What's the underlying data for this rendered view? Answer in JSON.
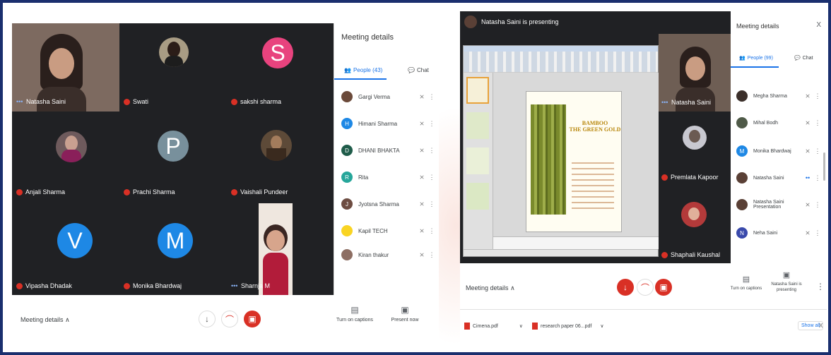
{
  "left": {
    "tiles": [
      {
        "name": "Natasha Saini"
      },
      {
        "name": "Swati"
      },
      {
        "name": "sakshi sharma",
        "initial": "S"
      },
      {
        "name": "Anjali Sharma"
      },
      {
        "name": "Prachi Sharma",
        "initial": "P"
      },
      {
        "name": "Vaishali Pundeer"
      },
      {
        "name": "Vipasha Dhadak",
        "initial": "V"
      },
      {
        "name": "Monika Bhardwaj",
        "initial": "M"
      },
      {
        "name": "Sharnja M"
      }
    ],
    "panel": {
      "title": "Meeting details",
      "tab_people": "People (43)",
      "tab_chat": "Chat",
      "people": [
        {
          "name": "Gargi Verma"
        },
        {
          "name": "Himani Sharma",
          "initial": "H"
        },
        {
          "name": "DHANI BHAKTA",
          "initial": "D"
        },
        {
          "name": "Rita",
          "initial": "R"
        },
        {
          "name": "Jyotsna Sharma",
          "initial": "J"
        },
        {
          "name": "Kapil TECH"
        },
        {
          "name": "Kiran thakur"
        }
      ]
    },
    "bottom": {
      "meeting_details": "Meeting details",
      "captions_label": "Turn on captions",
      "present_label": "Present now"
    }
  },
  "right": {
    "presenting_banner": "Natasha Saini is presenting",
    "slide": {
      "title_line1": "BAMBOO",
      "title_line2": "THE GREEN GOLD"
    },
    "side_tiles": [
      {
        "name": "Natasha Saini"
      },
      {
        "name": "Premlata Kapoor"
      },
      {
        "name": "Shaphali Kaushal"
      }
    ],
    "panel": {
      "title": "Meeting details",
      "close": "X",
      "tab_people": "People (99)",
      "tab_chat": "Chat",
      "people": [
        {
          "name": "Megha Sharma"
        },
        {
          "name": "Mihal Bodh"
        },
        {
          "name": "Monika Bhardwaj",
          "initial": "M"
        },
        {
          "name": "Natasha Saini"
        },
        {
          "name": "Natasha Saini Presentation"
        },
        {
          "name": "Neha Saini",
          "initial": "N"
        }
      ]
    },
    "bottom": {
      "meeting_details": "Meeting details",
      "captions_label": "Turn on captions",
      "presenting_label": "Natasha Saini is presenting"
    },
    "downloads": {
      "file1": "Cimena.pdf",
      "file2": "research paper 06...pdf",
      "show_all": "Show all",
      "close": "X"
    }
  },
  "colors": {
    "frame": "#1a2f6e",
    "stage": "#202124",
    "end_call": "#d93025",
    "accent": "#1a73e8"
  }
}
